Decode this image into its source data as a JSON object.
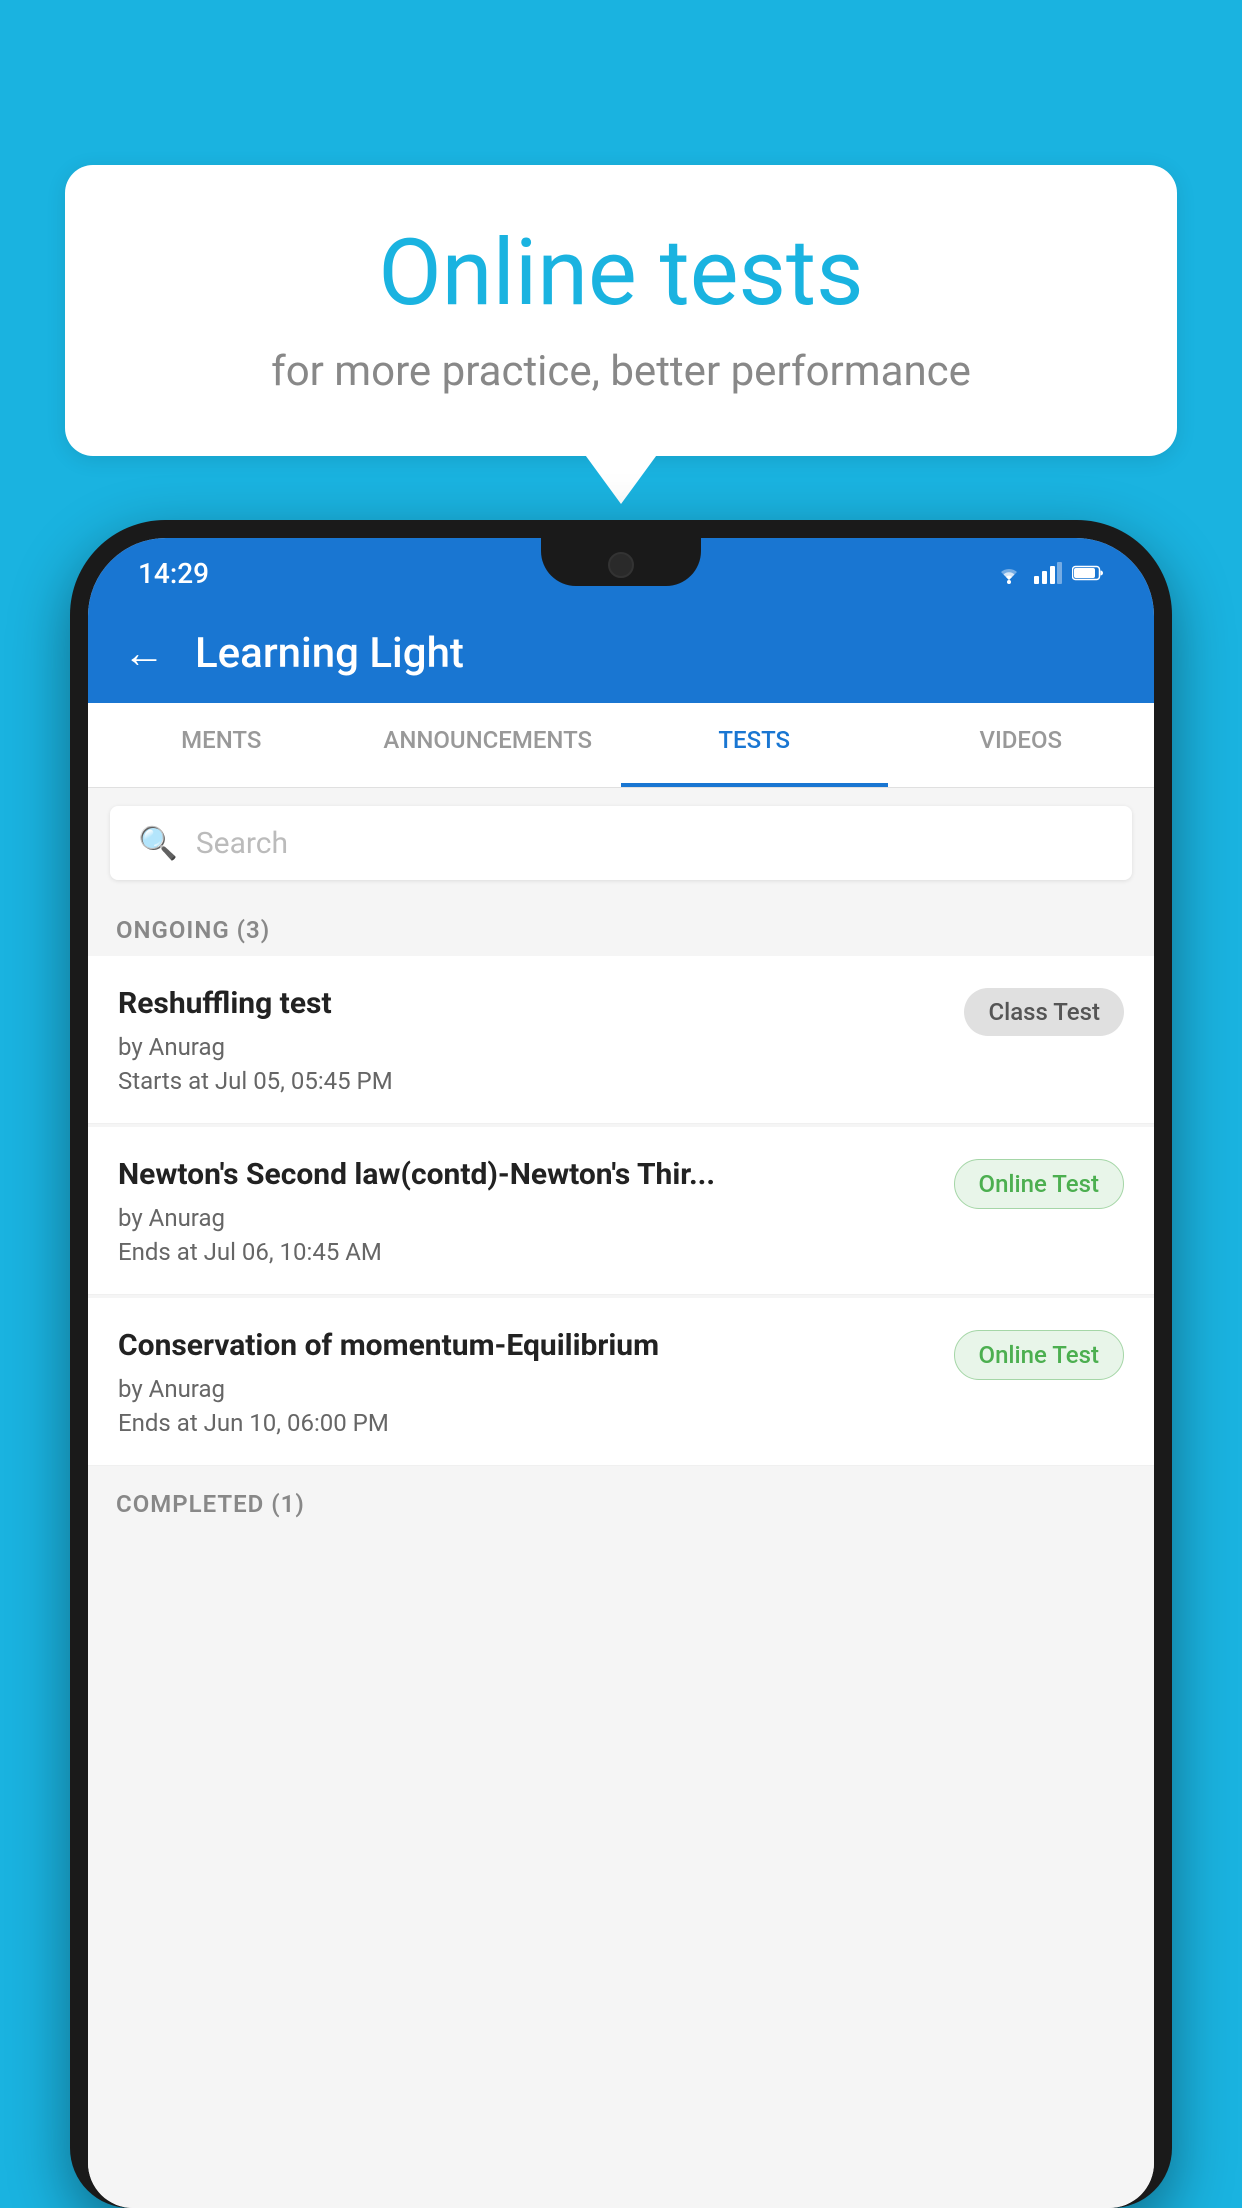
{
  "background": {
    "color": "#1ab3e0"
  },
  "bubble": {
    "title": "Online tests",
    "subtitle": "for more practice, better performance"
  },
  "phone": {
    "status_bar": {
      "time": "14:29",
      "icons": [
        "wifi",
        "signal",
        "battery"
      ]
    },
    "app_bar": {
      "back_label": "←",
      "title": "Learning Light"
    },
    "tabs": [
      {
        "label": "MENTS",
        "active": false
      },
      {
        "label": "ANNOUNCEMENTS",
        "active": false
      },
      {
        "label": "TESTS",
        "active": true
      },
      {
        "label": "VIDEOS",
        "active": false
      }
    ],
    "search": {
      "placeholder": "Search"
    },
    "sections": [
      {
        "header": "ONGOING (3)",
        "items": [
          {
            "name": "Reshuffling test",
            "author": "by Anurag",
            "date": "Starts at  Jul 05, 05:45 PM",
            "badge": "Class Test",
            "badge_type": "gray"
          },
          {
            "name": "Newton's Second law(contd)-Newton's Thir...",
            "author": "by Anurag",
            "date": "Ends at  Jul 06, 10:45 AM",
            "badge": "Online Test",
            "badge_type": "green"
          },
          {
            "name": "Conservation of momentum-Equilibrium",
            "author": "by Anurag",
            "date": "Ends at  Jun 10, 06:00 PM",
            "badge": "Online Test",
            "badge_type": "green"
          }
        ]
      },
      {
        "header": "COMPLETED (1)",
        "items": []
      }
    ]
  }
}
